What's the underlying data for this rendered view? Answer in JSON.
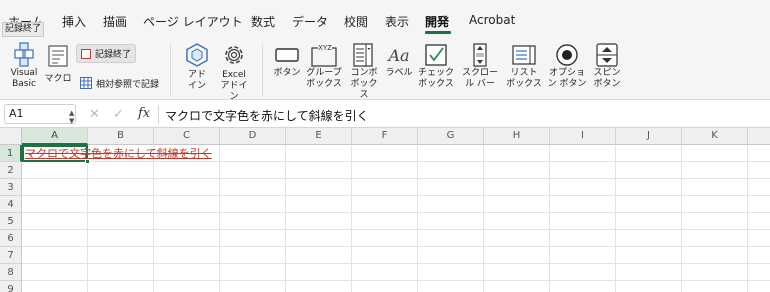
{
  "tabs": [
    {
      "label": "ホーム"
    },
    {
      "label": "挿入"
    },
    {
      "label": "描画"
    },
    {
      "label": "ページ レイアウト"
    },
    {
      "label": "数式"
    },
    {
      "label": "データ"
    },
    {
      "label": "校閲"
    },
    {
      "label": "表示"
    },
    {
      "label": "開発",
      "active": true
    },
    {
      "label": "Acrobat"
    }
  ],
  "tooltip": "記録終了",
  "ribbon": {
    "visual_basic": "Visual Basic",
    "macro": "マクロ",
    "stop_recording": "記録終了",
    "relative_reference": "相対参照で記録",
    "addins": "アド イン",
    "excel_addins": "Excel アドイン",
    "button": "ボタン",
    "group_box": "グループ ボックス",
    "combo_box": "コンボ ボックス",
    "label": "ラベル",
    "check_box": "チェック ボックス",
    "scroll_bar": "スクロール バー",
    "list_box": "リスト ボックス",
    "option_button": "オプション ボタン",
    "spin_button": "スピン ボタン",
    "xyz_glyph": "XYZ",
    "aa_glyph": "Aa"
  },
  "formula_bar": {
    "name_box": "A1",
    "fx": "fx",
    "formula": "マクロで文字色を赤にして斜線を引く"
  },
  "grid": {
    "columns": [
      "A",
      "B",
      "C",
      "D",
      "E",
      "F",
      "G",
      "H",
      "I",
      "J",
      "K"
    ],
    "rows": [
      "1",
      "2",
      "3",
      "4",
      "5",
      "6",
      "7",
      "8",
      "9"
    ],
    "a1_value": "マクロで文字色を赤にして斜線を引く",
    "a1_text_color": "#c0392b",
    "selection_color": "#1e7145"
  }
}
